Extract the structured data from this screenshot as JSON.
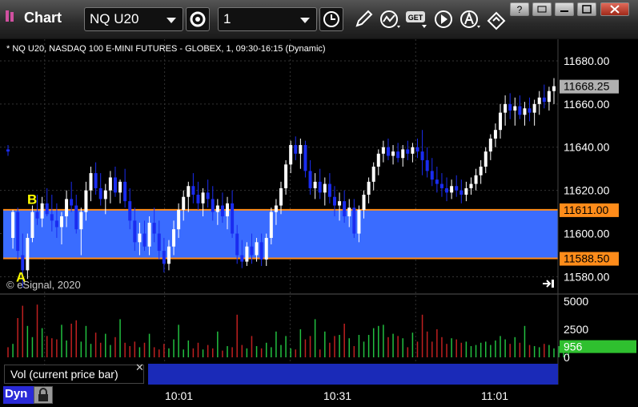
{
  "window": {
    "title": "Chart",
    "symbol": "NQ U20",
    "interval": "1",
    "icons": [
      "settings-icon",
      "clock-icon",
      "pencil-icon",
      "study-icon",
      "get-icon",
      "play-icon",
      "alert-icon",
      "link-icon"
    ]
  },
  "chart_header": "* NQ U20, NASDAQ 100 E-MINI FUTURES - GLOBEX, 1, 09:30-16:15 (Dynamic)",
  "watermark": "© eSignal, 2020",
  "vol_panel_label": "Vol (current price bar)",
  "dyn_label": "Dyn",
  "colors": {
    "up": "#ffffff",
    "down": "#1a2cf0",
    "zone": "#3a6cff",
    "zone_line": "#ff8c1a",
    "vol_up": "#22c040",
    "vol_down": "#c02020",
    "last_price": "#b0b0b0"
  },
  "chart_data": {
    "type": "candlestick",
    "price_axis": {
      "ylim": [
        11572,
        11690
      ],
      "ticks": [
        "11680.00",
        "11660.00",
        "11640.00",
        "11620.00",
        "11600.00",
        "11580.00"
      ]
    },
    "price_labels": {
      "last": "11668.25",
      "upper": "11611.00",
      "lower": "11588.50"
    },
    "zone": {
      "top": 11611.0,
      "bottom": 11588.5
    },
    "markers": [
      {
        "label": "A",
        "price": 11580
      },
      {
        "label": "B",
        "price": 11616
      }
    ],
    "time_labels": [
      "10:01",
      "10:31",
      "11:01"
    ],
    "volume_axis": {
      "ylim": [
        0,
        5500
      ],
      "ticks": [
        "5000",
        "2500",
        "0"
      ],
      "last": "956"
    },
    "bars": [
      [
        11639,
        11641,
        11636,
        11638
      ],
      [
        11598,
        11611,
        11593,
        11610
      ],
      [
        11610,
        11612,
        11588,
        11592
      ],
      [
        11590,
        11600,
        11575,
        11583
      ],
      [
        11583,
        11600,
        11579,
        11598
      ],
      [
        11598,
        11613,
        11596,
        11610
      ],
      [
        11610,
        11618,
        11604,
        11607
      ],
      [
        11607,
        11617,
        11603,
        11614
      ],
      [
        11614,
        11621,
        11608,
        11609
      ],
      [
        11609,
        11618,
        11601,
        11606
      ],
      [
        11606,
        11614,
        11598,
        11603
      ],
      [
        11603,
        11610,
        11595,
        11608
      ],
      [
        11608,
        11620,
        11603,
        11616
      ],
      [
        11616,
        11624,
        11610,
        11613
      ],
      [
        11613,
        11618,
        11600,
        11602
      ],
      [
        11602,
        11612,
        11590,
        11610
      ],
      [
        11610,
        11624,
        11606,
        11620
      ],
      [
        11620,
        11631,
        11615,
        11628
      ],
      [
        11628,
        11633,
        11618,
        11621
      ],
      [
        11621,
        11628,
        11613,
        11616
      ],
      [
        11616,
        11623,
        11609,
        11620
      ],
      [
        11620,
        11629,
        11614,
        11626
      ],
      [
        11626,
        11631,
        11617,
        11619
      ],
      [
        11619,
        11625,
        11614,
        11624
      ],
      [
        11624,
        11630,
        11612,
        11615
      ],
      [
        11615,
        11621,
        11602,
        11606
      ],
      [
        11606,
        11612,
        11592,
        11596
      ],
      [
        11596,
        11605,
        11590,
        11600
      ],
      [
        11600,
        11606,
        11592,
        11594
      ],
      [
        11594,
        11608,
        11590,
        11605
      ],
      [
        11605,
        11612,
        11596,
        11600
      ],
      [
        11600,
        11606,
        11588,
        11592
      ],
      [
        11592,
        11598,
        11582,
        11586
      ],
      [
        11586,
        11597,
        11583,
        11594
      ],
      [
        11594,
        11606,
        11590,
        11602
      ],
      [
        11602,
        11614,
        11598,
        11611
      ],
      [
        11611,
        11620,
        11606,
        11617
      ],
      [
        11617,
        11624,
        11610,
        11622
      ],
      [
        11622,
        11628,
        11614,
        11618
      ],
      [
        11618,
        11624,
        11611,
        11614
      ],
      [
        11614,
        11621,
        11608,
        11619
      ],
      [
        11619,
        11625,
        11612,
        11616
      ],
      [
        11616,
        11622,
        11606,
        11610
      ],
      [
        11610,
        11616,
        11604,
        11613
      ],
      [
        11613,
        11619,
        11605,
        11608
      ],
      [
        11608,
        11617,
        11602,
        11614
      ],
      [
        11614,
        11620,
        11598,
        11600
      ],
      [
        11600,
        11604,
        11586,
        11590
      ],
      [
        11590,
        11597,
        11584,
        11587
      ],
      [
        11587,
        11596,
        11585,
        11594
      ],
      [
        11594,
        11600,
        11586,
        11590
      ],
      [
        11590,
        11598,
        11587,
        11596
      ],
      [
        11596,
        11600,
        11585,
        11588
      ],
      [
        11588,
        11600,
        11585,
        11598
      ],
      [
        11598,
        11612,
        11595,
        11610
      ],
      [
        11610,
        11616,
        11604,
        11613
      ],
      [
        11613,
        11624,
        11609,
        11621
      ],
      [
        11621,
        11634,
        11618,
        11632
      ],
      [
        11632,
        11643,
        11628,
        11641
      ],
      [
        11641,
        11645,
        11634,
        11637
      ],
      [
        11637,
        11644,
        11630,
        11641
      ],
      [
        11641,
        11643,
        11626,
        11629
      ],
      [
        11629,
        11634,
        11618,
        11621
      ],
      [
        11621,
        11628,
        11616,
        11624
      ],
      [
        11624,
        11630,
        11616,
        11619
      ],
      [
        11619,
        11626,
        11613,
        11623
      ],
      [
        11623,
        11628,
        11614,
        11617
      ],
      [
        11617,
        11622,
        11608,
        11613
      ],
      [
        11613,
        11619,
        11606,
        11615
      ],
      [
        11615,
        11620,
        11605,
        11608
      ],
      [
        11608,
        11616,
        11603,
        11612
      ],
      [
        11612,
        11616,
        11598,
        11600
      ],
      [
        11600,
        11613,
        11596,
        11611
      ],
      [
        11611,
        11620,
        11607,
        11618
      ],
      [
        11618,
        11626,
        11614,
        11624
      ],
      [
        11624,
        11633,
        11620,
        11631
      ],
      [
        11631,
        11639,
        11627,
        11637
      ],
      [
        11637,
        11643,
        11633,
        11640
      ],
      [
        11640,
        11644,
        11634,
        11636
      ],
      [
        11636,
        11641,
        11632,
        11638
      ],
      [
        11638,
        11642,
        11633,
        11635
      ],
      [
        11635,
        11641,
        11631,
        11639
      ],
      [
        11639,
        11643,
        11634,
        11637
      ],
      [
        11637,
        11642,
        11633,
        11640
      ],
      [
        11640,
        11644,
        11635,
        11638
      ],
      [
        11638,
        11648,
        11627,
        11634
      ],
      [
        11634,
        11640,
        11626,
        11629
      ],
      [
        11629,
        11635,
        11622,
        11625
      ],
      [
        11625,
        11631,
        11619,
        11623
      ],
      [
        11623,
        11628,
        11617,
        11621
      ],
      [
        11621,
        11626,
        11615,
        11619
      ],
      [
        11619,
        11625,
        11616,
        11622
      ],
      [
        11622,
        11627,
        11617,
        11620
      ],
      [
        11620,
        11625,
        11614,
        11618
      ],
      [
        11618,
        11624,
        11615,
        11621
      ],
      [
        11621,
        11626,
        11618,
        11623
      ],
      [
        11623,
        11630,
        11620,
        11627
      ],
      [
        11627,
        11634,
        11623,
        11631
      ],
      [
        11631,
        11640,
        11628,
        11638
      ],
      [
        11638,
        11646,
        11634,
        11644
      ],
      [
        11644,
        11651,
        11640,
        11648
      ],
      [
        11648,
        11660,
        11644,
        11656
      ],
      [
        11656,
        11664,
        11650,
        11660
      ],
      [
        11660,
        11665,
        11653,
        11657
      ],
      [
        11657,
        11663,
        11650,
        11659
      ],
      [
        11659,
        11664,
        11653,
        11655
      ],
      [
        11655,
        11661,
        11650,
        11658
      ],
      [
        11658,
        11663,
        11652,
        11656
      ],
      [
        11656,
        11662,
        11650,
        11660
      ],
      [
        11660,
        11666,
        11655,
        11663
      ],
      [
        11663,
        11669,
        11658,
        11661
      ],
      [
        11661,
        11668,
        11657,
        11666
      ],
      [
        11666,
        11672,
        11660,
        11668.25
      ]
    ],
    "volume": [
      900,
      1200,
      3500,
      4600,
      2800,
      1800,
      4700,
      2600,
      1900,
      1700,
      1600,
      2900,
      1500,
      3000,
      3300,
      1400,
      2800,
      1200,
      2200,
      1300,
      2100,
      1100,
      1800,
      3400,
      1300,
      1000,
      1400,
      900,
      1300,
      2100,
      900,
      700,
      1200,
      800,
      1600,
      2900,
      700,
      1500,
      800,
      1300,
      700,
      1100,
      800,
      2300,
      600,
      1000,
      900,
      3800,
      1100,
      800,
      1900,
      1000,
      800,
      1300,
      900,
      2300,
      1100,
      1900,
      800,
      700,
      2500,
      1600,
      1900,
      3400,
      700,
      2300,
      1300,
      1900,
      2000,
      3000,
      1700,
      1000,
      2000,
      1400,
      2000,
      2600,
      2800,
      2900,
      1800,
      2100,
      1900,
      1700,
      900,
      2200,
      1400,
      3800,
      2300,
      1400,
      2500,
      1800,
      1200,
      1700,
      1600,
      1300,
      1400,
      1000,
      1100,
      1300,
      1400,
      1100,
      1500,
      1900,
      1600,
      1200,
      1800,
      1300,
      2800,
      1100,
      1000,
      900,
      1200,
      1100,
      800,
      1000,
      1100,
      956
    ]
  }
}
